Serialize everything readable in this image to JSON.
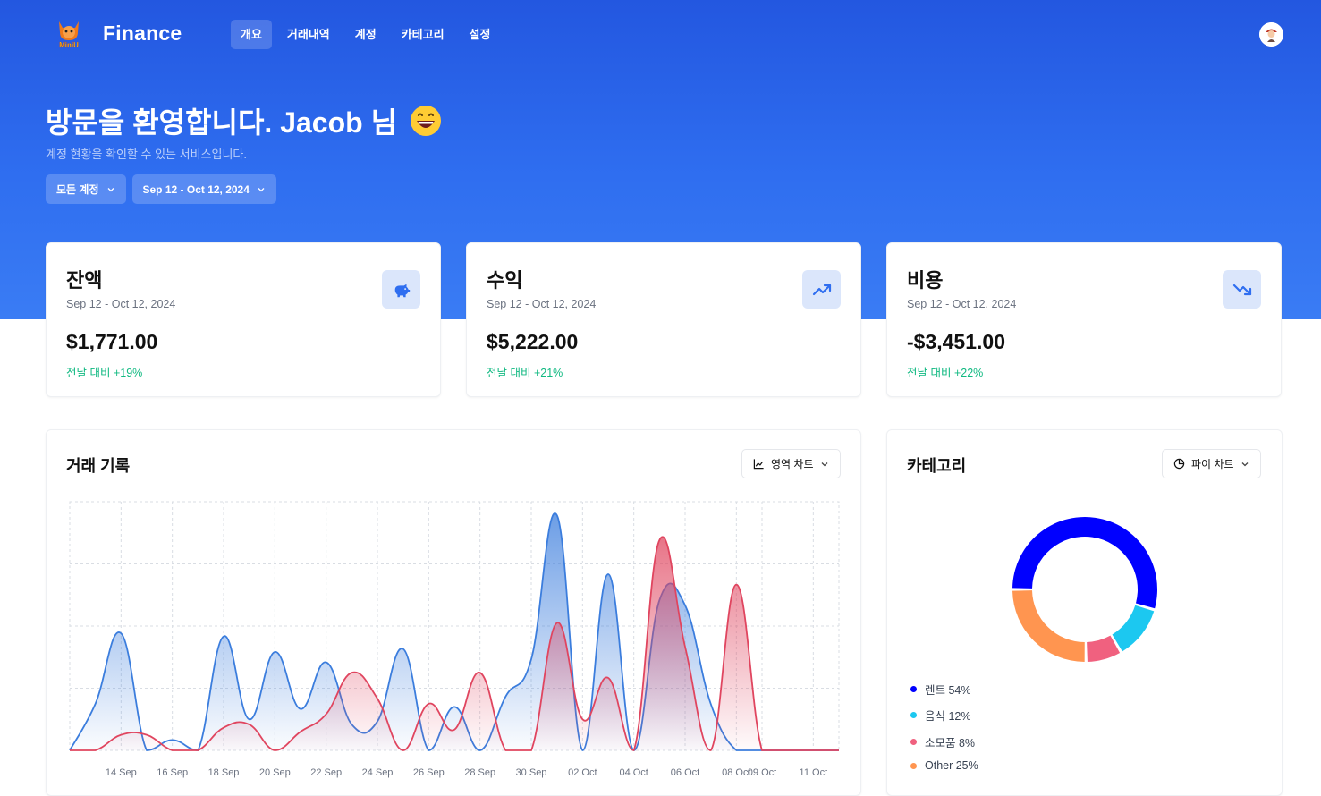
{
  "nav": {
    "brand": "Finance",
    "logo_text": "MiniU",
    "links": [
      {
        "label": "개요",
        "active": true
      },
      {
        "label": "거래내역",
        "active": false
      },
      {
        "label": "계정",
        "active": false
      },
      {
        "label": "카테고리",
        "active": false
      },
      {
        "label": "설정",
        "active": false
      }
    ]
  },
  "hero": {
    "welcome": "방문을 환영합니다. Jacob 님",
    "subtitle": "계정 현황을 확인할 수 있는 서비스입니다.",
    "account_filter": "모든 계정",
    "date_filter": "Sep 12 - Oct 12, 2024"
  },
  "stats": [
    {
      "title": "잔액",
      "period": "Sep 12 - Oct 12, 2024",
      "amount": "$1,771.00",
      "change_label": "전달 대비",
      "change": "+19%",
      "icon": "piggy-bank-icon"
    },
    {
      "title": "수익",
      "period": "Sep 12 - Oct 12, 2024",
      "amount": "$5,222.00",
      "change_label": "전달 대비",
      "change": "+21%",
      "icon": "trending-up-icon"
    },
    {
      "title": "비용",
      "period": "Sep 12 - Oct 12, 2024",
      "amount": "-$3,451.00",
      "change_label": "전달 대비",
      "change": "+22%",
      "icon": "trending-down-icon"
    }
  ],
  "colors": {
    "accent": "#2f6ef0",
    "income": "#3b7ddd",
    "expense": "#e0455f",
    "positive": "#10b981"
  },
  "transactions": {
    "title": "거래 기록",
    "chart_type_label": "영역 차트"
  },
  "categories": {
    "title": "카테고리",
    "chart_type_label": "파이 차트"
  },
  "chart_data": [
    {
      "type": "area",
      "title": "거래 기록",
      "x_ticks": [
        "14 Sep",
        "16 Sep",
        "18 Sep",
        "20 Sep",
        "22 Sep",
        "24 Sep",
        "26 Sep",
        "28 Sep",
        "30 Sep",
        "02 Oct",
        "04 Oct",
        "06 Oct",
        "08 Oct",
        "09 Oct",
        "11 Oct"
      ],
      "x": [
        "12 Sep",
        "13 Sep",
        "14 Sep",
        "15 Sep",
        "16 Sep",
        "17 Sep",
        "18 Sep",
        "19 Sep",
        "20 Sep",
        "21 Sep",
        "22 Sep",
        "23 Sep",
        "24 Sep",
        "25 Sep",
        "26 Sep",
        "27 Sep",
        "28 Sep",
        "29 Sep",
        "30 Sep",
        "01 Oct",
        "02 Oct",
        "03 Oct",
        "04 Oct",
        "05 Oct",
        "06 Oct",
        "07 Oct",
        "08 Oct",
        "09 Oct",
        "10 Oct",
        "11 Oct",
        "12 Oct"
      ],
      "grid": true,
      "series": [
        {
          "values": [
            0,
            45,
            113,
            0,
            10,
            0,
            110,
            30,
            95,
            40,
            85,
            25,
            28,
            98,
            0,
            42,
            0,
            52,
            88,
            227,
            0,
            170,
            0,
            145,
            140,
            45,
            0,
            0,
            0,
            0,
            0
          ]
        },
        {
          "values": [
            0,
            0,
            15,
            15,
            0,
            0,
            22,
            25,
            0,
            18,
            35,
            75,
            50,
            0,
            45,
            20,
            75,
            0,
            0,
            123,
            30,
            70,
            0,
            203,
            100,
            0,
            160,
            0,
            0,
            0,
            0
          ]
        }
      ]
    },
    {
      "type": "pie",
      "title": "카테고리",
      "slices": [
        {
          "label": "렌트",
          "value": 54,
          "color": "#0000ff",
          "display": "렌트 54%"
        },
        {
          "label": "음식",
          "value": 12,
          "color": "#1cc8f0",
          "display": "음식 12%"
        },
        {
          "label": "소모품",
          "value": 8,
          "color": "#f0617f",
          "display": "소모품 8%"
        },
        {
          "label": "Other",
          "value": 25,
          "color": "#ff9550",
          "display": "Other 25%"
        }
      ]
    }
  ]
}
